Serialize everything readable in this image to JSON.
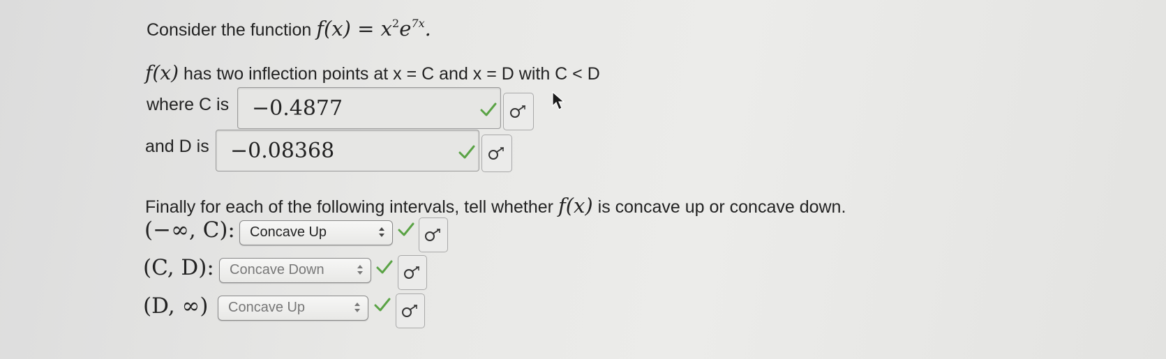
{
  "question": {
    "intro": "Consider the function",
    "function_expr": "f(x) = x",
    "function_exp_base": "e",
    "function_exponent": "7x",
    "inflection_prefix": "f(x)",
    "inflection_text": "has two inflection points at x = C and x = D with C < D",
    "where_c_label": "where C is",
    "and_d_label": "and D is",
    "concavity_prompt": "Finally for each of the following intervals, tell whether",
    "concavity_fx": "f(x)",
    "concavity_suffix": "is concave up or concave down."
  },
  "answers": {
    "c_value": "−0.4877",
    "d_value": "−0.08368"
  },
  "intervals": [
    {
      "label": "(−∞, C):",
      "selected": "Concave Up"
    },
    {
      "label": "(C, D):",
      "selected": "Concave Down"
    },
    {
      "label": "(D, ∞)",
      "selected": "Concave Up"
    }
  ],
  "colors": {
    "check": "#5aa345",
    "text": "#222222"
  },
  "icons": {
    "check": "checkmark-icon",
    "key": "answer-key-icon",
    "cursor": "mouse-pointer-icon",
    "select": "select-arrows-icon"
  }
}
